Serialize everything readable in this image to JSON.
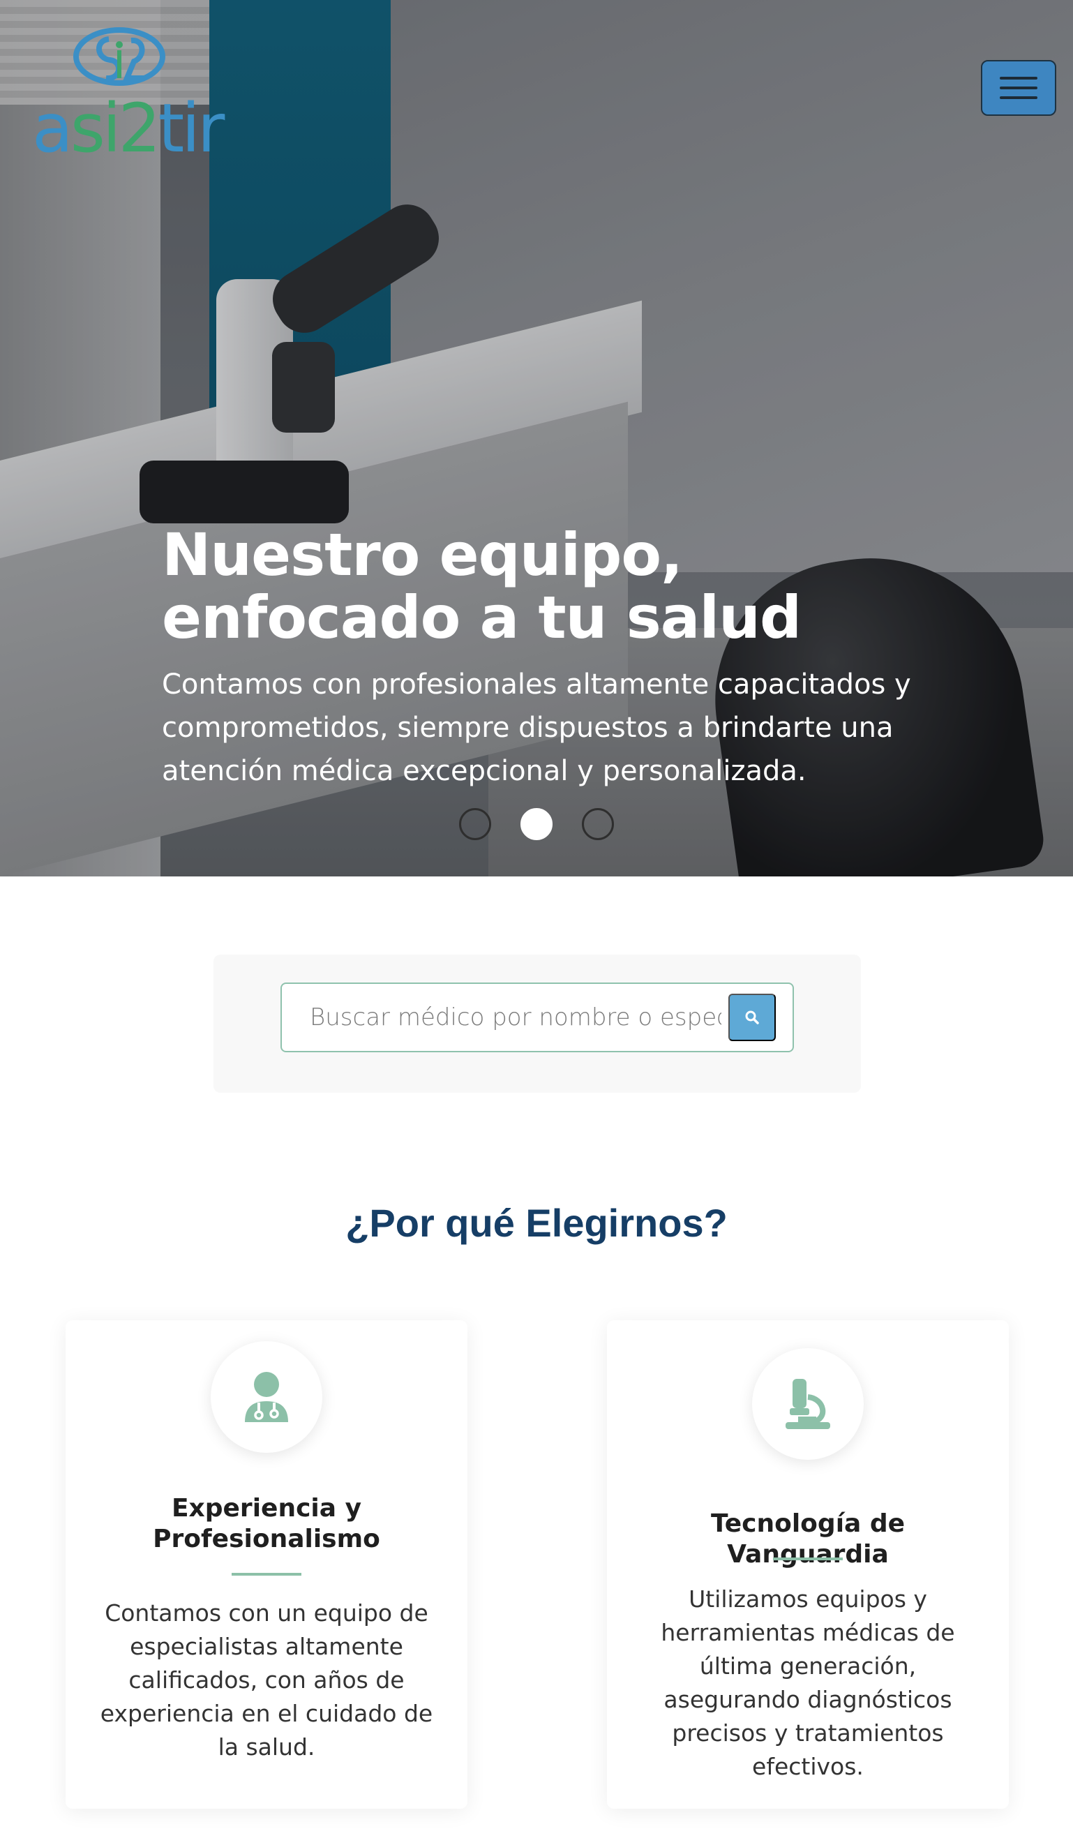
{
  "brand": {
    "logo_text_prefix": "a",
    "logo_text_mid": "si2",
    "logo_text_suffix": "tir",
    "colors": {
      "blue": "#3b8fc6",
      "green": "#3ea56b"
    }
  },
  "nav": {
    "menu_icon": "hamburger-icon"
  },
  "hero": {
    "title": "Nuestro equipo, enfocado a tu salud",
    "subtitle": "Contamos con profesionales altamente capacitados y comprometidos, siempre dispuestos a brindarte una atención médica excepcional y personalizada.",
    "slides_total": 3,
    "active_slide": 2
  },
  "search": {
    "placeholder": "Buscar médico por nombre o especialidad",
    "button_icon": "search-icon"
  },
  "why": {
    "title": "¿Por qué Elegirnos?",
    "cards": [
      {
        "icon": "doctor-icon",
        "title": "Experiencia y Profesionalismo",
        "text": "Contamos con un equipo de especialistas altamente calificados, con años de experiencia en el cuidado de la salud."
      },
      {
        "icon": "microscope-icon",
        "title": "Tecnología de Vanguardia",
        "text": "Utilizamos equipos y herramientas médicas de última generación, asegurando diagnósticos precisos y tratamientos efectivos."
      }
    ]
  },
  "colors": {
    "accent": "#8cc0a8",
    "heading": "#163e66",
    "button": "#3e86c1"
  }
}
